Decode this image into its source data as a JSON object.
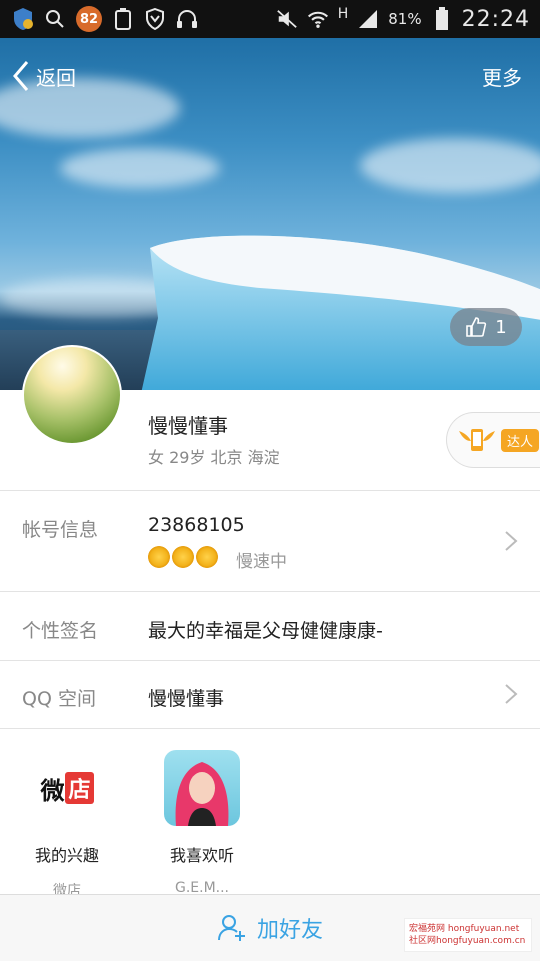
{
  "status_bar": {
    "notification_count": "82",
    "network": "H",
    "battery": "81%",
    "time": "22:24"
  },
  "header": {
    "back_label": "返回",
    "more_label": "更多",
    "like_count": "1"
  },
  "profile": {
    "nickname": "慢慢懂事",
    "meta": "女 29岁 北京 海淀",
    "talent_badge": "达人"
  },
  "rows": {
    "account": {
      "label": "帐号信息",
      "qq_number": "23868105",
      "speed": "慢速中"
    },
    "signature": {
      "label": "个性签名",
      "value": "最大的幸福是父母健健康康-"
    },
    "qzone": {
      "label": "QQ 空间",
      "value": "慢慢懂事"
    }
  },
  "apps": [
    {
      "label": "我的兴趣",
      "sub": "微店",
      "icon_text": "微",
      "icon_text2": "店"
    },
    {
      "label": "我喜欢听",
      "sub": "G.E.M..."
    }
  ],
  "bottom": {
    "add_friend": "加好友"
  },
  "watermark": {
    "line1": "宏福苑网 hongfuyuan.net",
    "line2": "社区网hongfuyuan.com.cn"
  },
  "colors": {
    "accent": "#3aa3e3",
    "badge": "#d86b2b",
    "talent": "#f5a623"
  }
}
